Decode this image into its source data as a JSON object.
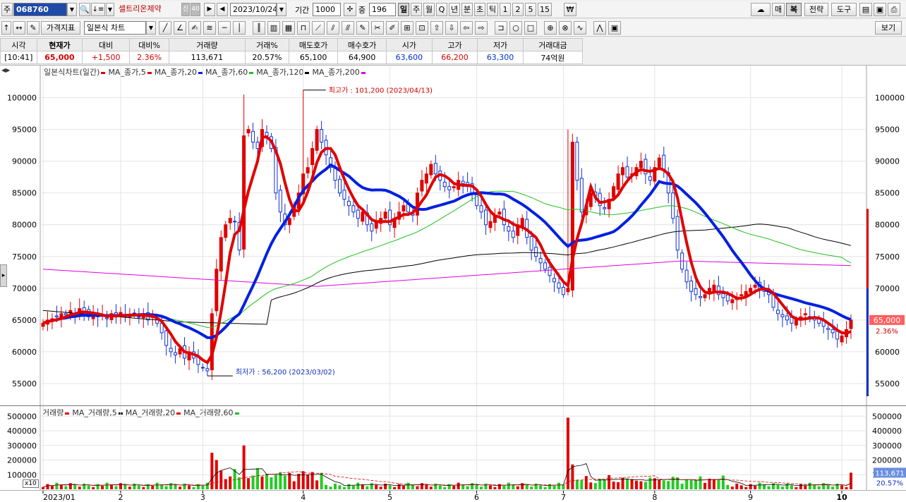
{
  "toolbar1": {
    "market_label": "주",
    "stock_code": "068760",
    "stock_name": "셀트리온제약",
    "badge1": "신",
    "badge2": "40",
    "date": "2023/10/24",
    "period_label": "기간",
    "period_value": "1000",
    "zoom_label": "중",
    "zoom_value": "196",
    "timeframes": [
      "일",
      "주",
      "월",
      "Q",
      "년",
      "분",
      "초",
      "틱",
      "1",
      "2",
      "5",
      "15"
    ],
    "currency_icon": "won-sign-icon",
    "right_buttons": [
      "매",
      "복",
      "전략",
      "도구"
    ]
  },
  "toolbar2": {
    "indicator_button": "가격지표",
    "chart_type": "일본식 차트",
    "view_button": "보기"
  },
  "quote": {
    "headers": [
      "시각",
      "현재가",
      "대비",
      "대비%",
      "거래량",
      "거래%",
      "매도호가",
      "매수호가",
      "시가",
      "고가",
      "저가",
      "거래대금"
    ],
    "values": [
      "[10:41]",
      "65,000",
      "+1,500",
      "2.36%",
      "113,671",
      "20.57%",
      "65,100",
      "64,900",
      "63,600",
      "66,200",
      "63,300",
      "74억원"
    ]
  },
  "price_panel": {
    "legend": [
      {
        "label": "일본식차트(일간)",
        "color": "#e00000"
      },
      {
        "label": "MA_종가,5",
        "color": "#e00000"
      },
      {
        "label": "MA_종가,20",
        "color": "#0020e0"
      },
      {
        "label": "MA_종가,60",
        "color": "#20c020"
      },
      {
        "label": "MA_종가,120",
        "color": "#000000"
      },
      {
        "label": "MA_종가,200",
        "color": "#e000e0"
      }
    ],
    "high_annotation": "최고가 : 101,200 (2023/04/13)",
    "low_annotation": "최저가 : 56,200 (2023/03/02)",
    "current_price_tag": "65,000",
    "current_pct_tag": "2.36%"
  },
  "volume_panel": {
    "legend": [
      {
        "label": "거래량",
        "color": "#e00000"
      },
      {
        "label": "MA_거래량,5",
        "color": "#000000"
      },
      {
        "label": "MA_거래량,20",
        "color": "#e00000"
      },
      {
        "label": "MA_거래량,60",
        "color": "#20c020"
      }
    ],
    "scale_button": "x10",
    "current_volume_tag": "113,671",
    "current_pct_tag": "20.57%"
  },
  "chart_data": {
    "type": "candlestick",
    "title": "",
    "price_axis": {
      "ticks": [
        55000,
        60000,
        65000,
        70000,
        75000,
        80000,
        85000,
        90000,
        95000,
        100000
      ],
      "ylim": [
        52000,
        103500
      ]
    },
    "volume_axis": {
      "ticks": [
        100000,
        200000,
        300000,
        400000,
        500000
      ],
      "ylim": [
        0,
        540000
      ]
    },
    "x_ticks": [
      "2023/01",
      "2",
      "3",
      "4",
      "5",
      "6",
      "7",
      "8",
      "9",
      "10"
    ],
    "month_start_index": [
      0,
      17,
      35,
      57,
      76,
      95,
      114,
      134,
      155,
      175
    ],
    "close": [
      64500,
      65000,
      65200,
      65500,
      66000,
      65800,
      66500,
      66000,
      66800,
      66200,
      65500,
      66000,
      65500,
      65800,
      65200,
      66000,
      65500,
      66200,
      65500,
      65800,
      66000,
      65500,
      66000,
      65000,
      65500,
      64500,
      63000,
      61000,
      60000,
      59500,
      60500,
      59000,
      60000,
      59000,
      58000,
      57500,
      57000,
      66000,
      73000,
      78000,
      80000,
      81000,
      80500,
      76000,
      94000,
      95000,
      93000,
      92000,
      95000,
      94000,
      92000,
      85000,
      82000,
      80000,
      81000,
      83000,
      85000,
      88000,
      89000,
      92000,
      95000,
      93000,
      91000,
      89000,
      87000,
      85000,
      84000,
      83000,
      82000,
      81000,
      82000,
      80000,
      79000,
      80500,
      81000,
      82000,
      80000,
      81000,
      82000,
      83000,
      82000,
      81500,
      85000,
      87000,
      88000,
      89500,
      88000,
      87000,
      86000,
      85500,
      86000,
      87000,
      86500,
      86000,
      85000,
      83000,
      82000,
      80000,
      80500,
      81500,
      82000,
      80000,
      79000,
      78000,
      80000,
      81000,
      78000,
      76000,
      75000,
      74000,
      73000,
      72000,
      71000,
      70000,
      69000,
      70000,
      93000,
      87000,
      82000,
      83000,
      85000,
      84500,
      83000,
      82500,
      84000,
      86000,
      88000,
      89000,
      87500,
      88000,
      89000,
      90000,
      88000,
      87000,
      89000,
      90500,
      88500,
      85000,
      81000,
      76000,
      73000,
      71000,
      69500,
      69000,
      68500,
      69000,
      70000,
      70500,
      69000,
      68500,
      68000,
      68200,
      68500,
      69000,
      69500,
      70000,
      70500,
      70000,
      69500,
      69000,
      67000,
      66000,
      65500,
      65000,
      64500,
      65000,
      65500,
      66000,
      65500,
      65000,
      64500,
      64000,
      63500,
      63000,
      62000,
      62500,
      63500,
      65000
    ],
    "series": [
      {
        "name": "MA_종가,5",
        "values_note_key": "ma5"
      },
      {
        "name": "MA_종가,20"
      },
      {
        "name": "MA_종가,60"
      },
      {
        "name": "MA_종가,120"
      },
      {
        "name": "MA_종가,200"
      }
    ],
    "volume_spikes": [
      {
        "index": 37,
        "volume": 250000
      },
      {
        "index": 38,
        "volume": 200000
      },
      {
        "index": 44,
        "volume": 300000
      },
      {
        "index": 115,
        "volume": 490000
      },
      {
        "index": 116,
        "volume": 170000
      }
    ],
    "last_volume": 113671
  }
}
